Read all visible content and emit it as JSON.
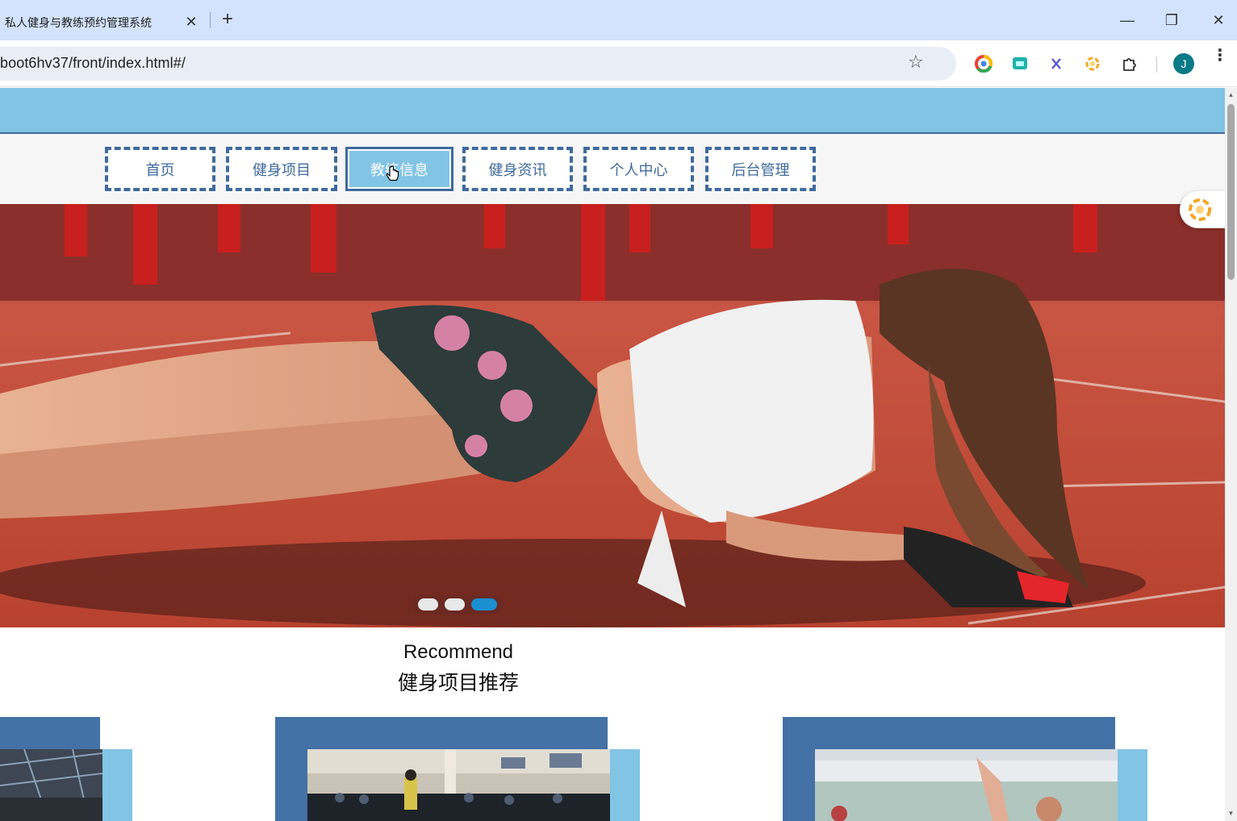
{
  "browser": {
    "tab_title": "私人健身与教练预约管理系统",
    "tab_close": "✕",
    "new_tab": "+",
    "url": "boot6hv37/front/index.html#/",
    "avatar_letter": "J",
    "window_controls": [
      "—",
      "❐",
      "✕"
    ]
  },
  "nav": {
    "items": [
      {
        "label": "首页",
        "active": false
      },
      {
        "label": "健身项目",
        "active": false
      },
      {
        "label": "教练信息",
        "active": true
      },
      {
        "label": "健身资讯",
        "active": false
      },
      {
        "label": "个人中心",
        "active": false
      },
      {
        "label": "后台管理",
        "active": false
      }
    ]
  },
  "carousel": {
    "slide_count": 3,
    "active_index": 2
  },
  "recommend": {
    "title": "Recommend",
    "subtitle": "健身项目推荐"
  },
  "colors": {
    "top_band": "#82c4e4",
    "nav_border": "#3f6a9c",
    "card_back": "#4471a6",
    "card_accent": "#82c4e4",
    "dot_active": "#1b8fd2"
  },
  "icons": [
    "star-icon",
    "chrome-ext-icon",
    "chat-ext-icon",
    "x-ext-icon",
    "sun-ext-icon",
    "puzzle-icon",
    "kebab-menu-icon"
  ]
}
